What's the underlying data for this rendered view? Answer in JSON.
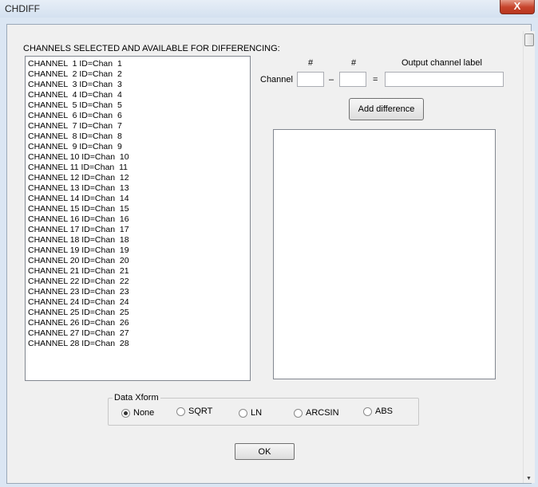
{
  "window": {
    "title": "CHDIFF",
    "close_glyph": "X"
  },
  "channels": {
    "heading": "CHANNELS SELECTED AND AVAILABLE FOR DIFFERENCING:",
    "items": [
      "CHANNEL  1 ID=Chan  1",
      "CHANNEL  2 ID=Chan  2",
      "CHANNEL  3 ID=Chan  3",
      "CHANNEL  4 ID=Chan  4",
      "CHANNEL  5 ID=Chan  5",
      "CHANNEL  6 ID=Chan  6",
      "CHANNEL  7 ID=Chan  7",
      "CHANNEL  8 ID=Chan  8",
      "CHANNEL  9 ID=Chan  9",
      "CHANNEL 10 ID=Chan  10",
      "CHANNEL 11 ID=Chan  11",
      "CHANNEL 12 ID=Chan  12",
      "CHANNEL 13 ID=Chan  13",
      "CHANNEL 14 ID=Chan  14",
      "CHANNEL 15 ID=Chan  15",
      "CHANNEL 16 ID=Chan  16",
      "CHANNEL 17 ID=Chan  17",
      "CHANNEL 18 ID=Chan  18",
      "CHANNEL 19 ID=Chan  19",
      "CHANNEL 20 ID=Chan  20",
      "CHANNEL 21 ID=Chan  21",
      "CHANNEL 22 ID=Chan  22",
      "CHANNEL 23 ID=Chan  23",
      "CHANNEL 24 ID=Chan  24",
      "CHANNEL 25 ID=Chan  25",
      "CHANNEL 26 ID=Chan  26",
      "CHANNEL 27 ID=Chan  27",
      "CHANNEL 28 ID=Chan  28"
    ]
  },
  "difference": {
    "hash_label_a": "#",
    "hash_label_b": "#",
    "output_label_heading": "Output channel label",
    "channel_label": "Channel",
    "minus": "–",
    "equals": "=",
    "channel_a_value": "",
    "channel_b_value": "",
    "output_label_value": "",
    "add_button": "Add difference",
    "differences": []
  },
  "xform": {
    "title": "Data Xform",
    "options": [
      "None",
      "SQRT",
      "LN",
      "ARCSIN",
      "ABS"
    ],
    "selected": "None"
  },
  "ok_button": "OK"
}
